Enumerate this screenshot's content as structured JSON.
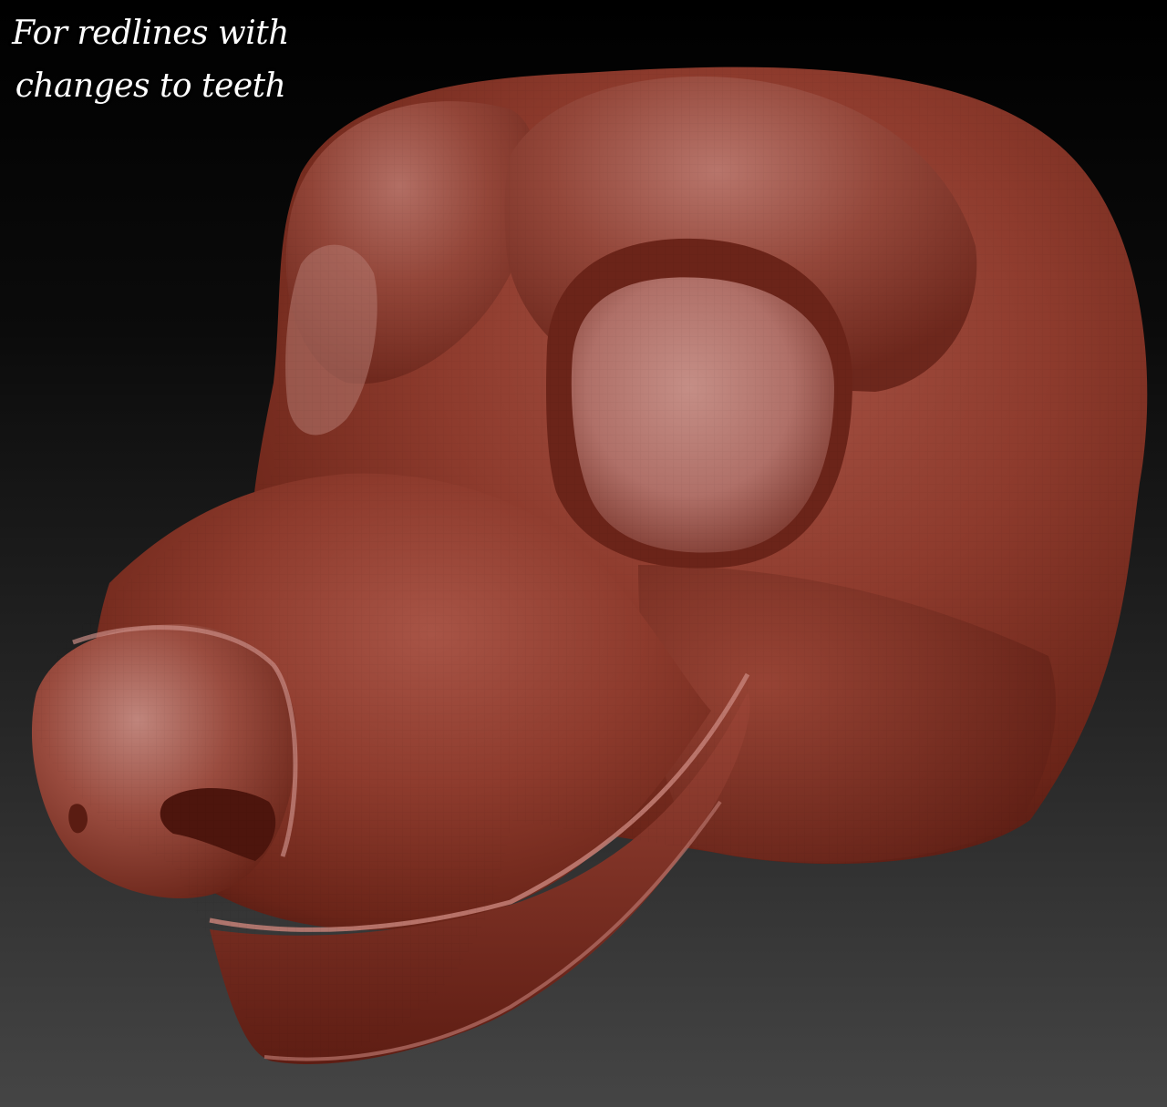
{
  "caption": {
    "line1": "For redlines with",
    "line2": "changes to teeth"
  },
  "colors": {
    "background_top": "#000000",
    "background_bottom": "#454545",
    "clay_base": "#8a3a2c",
    "clay_highlight": "#c2857c",
    "clay_shadow": "#4a1710"
  }
}
